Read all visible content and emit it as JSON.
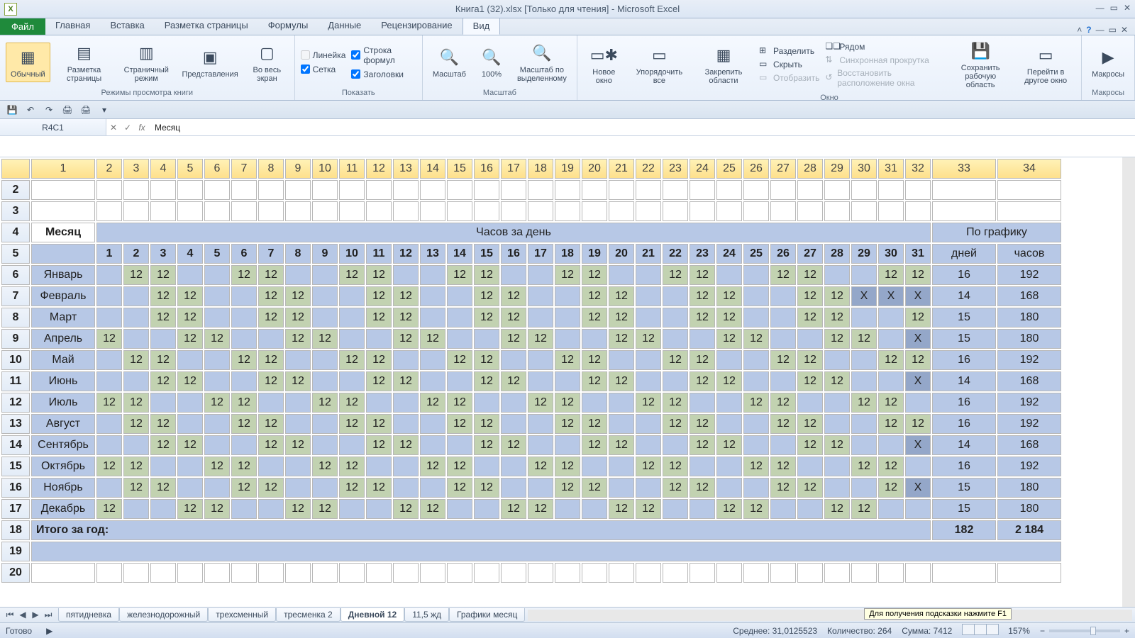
{
  "app": {
    "title": "Книга1 (32).xlsx  [Только для чтения]  -  Microsoft Excel",
    "file_label": "Файл"
  },
  "ribbon_tabs": [
    "Главная",
    "Вставка",
    "Разметка страницы",
    "Формулы",
    "Данные",
    "Рецензирование",
    "Вид"
  ],
  "ribbon_active_idx": 6,
  "ribbon": {
    "modes": {
      "normal": "Обычный",
      "layout": "Разметка\nстраницы",
      "pagebreak": "Страничный\nрежим",
      "custom": "Представления",
      "full": "Во весь\nэкран",
      "group": "Режимы просмотра книги"
    },
    "show": {
      "ruler": "Линейка",
      "formula": "Строка формул",
      "grid": "Сетка",
      "headings": "Заголовки",
      "group": "Показать"
    },
    "zoom": {
      "zoom": "Масштаб",
      "z100": "100%",
      "zsel": "Масштаб по\nвыделенному",
      "group": "Масштаб"
    },
    "window": {
      "new": "Новое\nокно",
      "arrange": "Упорядочить\nвсе",
      "freeze": "Закрепить\nобласти",
      "split": "Разделить",
      "hide": "Скрыть",
      "unhide": "Отобразить",
      "side": "Рядом",
      "sync": "Синхронная прокрутка",
      "reset": "Восстановить расположение окна",
      "save": "Сохранить\nрабочую область",
      "switch": "Перейти в\nдругое окно",
      "group": "Окно"
    },
    "macros": {
      "macros": "Макросы",
      "group": "Макросы"
    }
  },
  "namebox": "R4C1",
  "formula": "Месяц",
  "columns": [
    "1",
    "2",
    "3",
    "4",
    "5",
    "6",
    "7",
    "8",
    "9",
    "10",
    "11",
    "12",
    "13",
    "14",
    "15",
    "16",
    "17",
    "18",
    "19",
    "20",
    "21",
    "22",
    "23",
    "24",
    "25",
    "26",
    "27",
    "28",
    "29",
    "30",
    "31",
    "32",
    "33",
    "34"
  ],
  "rowheads": [
    "2",
    "3",
    "4",
    "5",
    "6",
    "7",
    "8",
    "9",
    "10",
    "11",
    "12",
    "13",
    "14",
    "15",
    "16",
    "17",
    "18",
    "19",
    "20"
  ],
  "labels": {
    "month": "Месяц",
    "hoursPerDay": "Часов за день",
    "bySchedule": "По графику",
    "days": "дней",
    "hours": "часов",
    "yearTotal": "Итого за год:"
  },
  "dayNums": [
    "1",
    "2",
    "3",
    "4",
    "5",
    "6",
    "7",
    "8",
    "9",
    "10",
    "11",
    "12",
    "13",
    "14",
    "15",
    "16",
    "17",
    "18",
    "19",
    "20",
    "21",
    "22",
    "23",
    "24",
    "25",
    "26",
    "27",
    "28",
    "29",
    "30",
    "31"
  ],
  "months": [
    {
      "name": "Январь",
      "d": [
        "",
        "12",
        "12",
        "",
        "",
        "12",
        "12",
        "",
        "",
        "12",
        "12",
        "",
        "",
        "12",
        "12",
        "",
        "",
        "12",
        "12",
        "",
        "",
        "12",
        "12",
        "",
        "",
        "12",
        "12",
        "",
        "",
        "12",
        "12"
      ],
      "days": "16",
      "hours": "192"
    },
    {
      "name": "Февраль",
      "d": [
        "",
        "",
        "12",
        "12",
        "",
        "",
        "12",
        "12",
        "",
        "",
        "12",
        "12",
        "",
        "",
        "12",
        "12",
        "",
        "",
        "12",
        "12",
        "",
        "",
        "12",
        "12",
        "",
        "",
        "12",
        "12",
        "X",
        "X",
        "X"
      ],
      "days": "14",
      "hours": "168"
    },
    {
      "name": "Март",
      "d": [
        "",
        "",
        "12",
        "12",
        "",
        "",
        "12",
        "12",
        "",
        "",
        "12",
        "12",
        "",
        "",
        "12",
        "12",
        "",
        "",
        "12",
        "12",
        "",
        "",
        "12",
        "12",
        "",
        "",
        "12",
        "12",
        "",
        "",
        "12"
      ],
      "days": "15",
      "hours": "180"
    },
    {
      "name": "Апрель",
      "d": [
        "12",
        "",
        "",
        "12",
        "12",
        "",
        "",
        "12",
        "12",
        "",
        "",
        "12",
        "12",
        "",
        "",
        "12",
        "12",
        "",
        "",
        "12",
        "12",
        "",
        "",
        "12",
        "12",
        "",
        "",
        "12",
        "12",
        "",
        "X"
      ],
      "days": "15",
      "hours": "180"
    },
    {
      "name": "Май",
      "d": [
        "",
        "12",
        "12",
        "",
        "",
        "12",
        "12",
        "",
        "",
        "12",
        "12",
        "",
        "",
        "12",
        "12",
        "",
        "",
        "12",
        "12",
        "",
        "",
        "12",
        "12",
        "",
        "",
        "12",
        "12",
        "",
        "",
        "12",
        "12"
      ],
      "days": "16",
      "hours": "192"
    },
    {
      "name": "Июнь",
      "d": [
        "",
        "",
        "12",
        "12",
        "",
        "",
        "12",
        "12",
        "",
        "",
        "12",
        "12",
        "",
        "",
        "12",
        "12",
        "",
        "",
        "12",
        "12",
        "",
        "",
        "12",
        "12",
        "",
        "",
        "12",
        "12",
        "",
        "",
        "X"
      ],
      "days": "14",
      "hours": "168"
    },
    {
      "name": "Июль",
      "d": [
        "12",
        "12",
        "",
        "",
        "12",
        "12",
        "",
        "",
        "12",
        "12",
        "",
        "",
        "12",
        "12",
        "",
        "",
        "12",
        "12",
        "",
        "",
        "12",
        "12",
        "",
        "",
        "12",
        "12",
        "",
        "",
        "12",
        "12",
        ""
      ],
      "days": "16",
      "hours": "192"
    },
    {
      "name": "Август",
      "d": [
        "",
        "12",
        "12",
        "",
        "",
        "12",
        "12",
        "",
        "",
        "12",
        "12",
        "",
        "",
        "12",
        "12",
        "",
        "",
        "12",
        "12",
        "",
        "",
        "12",
        "12",
        "",
        "",
        "12",
        "12",
        "",
        "",
        "12",
        "12"
      ],
      "days": "16",
      "hours": "192"
    },
    {
      "name": "Сентябрь",
      "d": [
        "",
        "",
        "12",
        "12",
        "",
        "",
        "12",
        "12",
        "",
        "",
        "12",
        "12",
        "",
        "",
        "12",
        "12",
        "",
        "",
        "12",
        "12",
        "",
        "",
        "12",
        "12",
        "",
        "",
        "12",
        "12",
        "",
        "",
        "X"
      ],
      "days": "14",
      "hours": "168"
    },
    {
      "name": "Октябрь",
      "d": [
        "12",
        "12",
        "",
        "",
        "12",
        "12",
        "",
        "",
        "12",
        "12",
        "",
        "",
        "12",
        "12",
        "",
        "",
        "12",
        "12",
        "",
        "",
        "12",
        "12",
        "",
        "",
        "12",
        "12",
        "",
        "",
        "12",
        "12",
        ""
      ],
      "days": "16",
      "hours": "192"
    },
    {
      "name": "Ноябрь",
      "d": [
        "",
        "12",
        "12",
        "",
        "",
        "12",
        "12",
        "",
        "",
        "12",
        "12",
        "",
        "",
        "12",
        "12",
        "",
        "",
        "12",
        "12",
        "",
        "",
        "12",
        "12",
        "",
        "",
        "12",
        "12",
        "",
        "",
        "12",
        "X"
      ],
      "days": "15",
      "hours": "180"
    },
    {
      "name": "Декабрь",
      "d": [
        "12",
        "",
        "",
        "12",
        "12",
        "",
        "",
        "12",
        "12",
        "",
        "",
        "12",
        "12",
        "",
        "",
        "12",
        "12",
        "",
        "",
        "12",
        "12",
        "",
        "",
        "12",
        "12",
        "",
        "",
        "12",
        "12",
        "",
        ""
      ],
      "days": "15",
      "hours": "180"
    }
  ],
  "totals": {
    "days": "182",
    "hours": "2 184"
  },
  "sheets": [
    "пятидневка",
    "железнодорожный",
    "трехсменный",
    "тресменка 2",
    "Дневной 12",
    "11,5 жд",
    "Графики месяц"
  ],
  "sheet_active_idx": 4,
  "tooltip": "Для получения подсказки нажмите F1",
  "status": {
    "ready": "Готово",
    "avg": "Среднее: 31,0125523",
    "count": "Количество: 264",
    "sum": "Сумма: 7412",
    "zoom": "157%"
  }
}
